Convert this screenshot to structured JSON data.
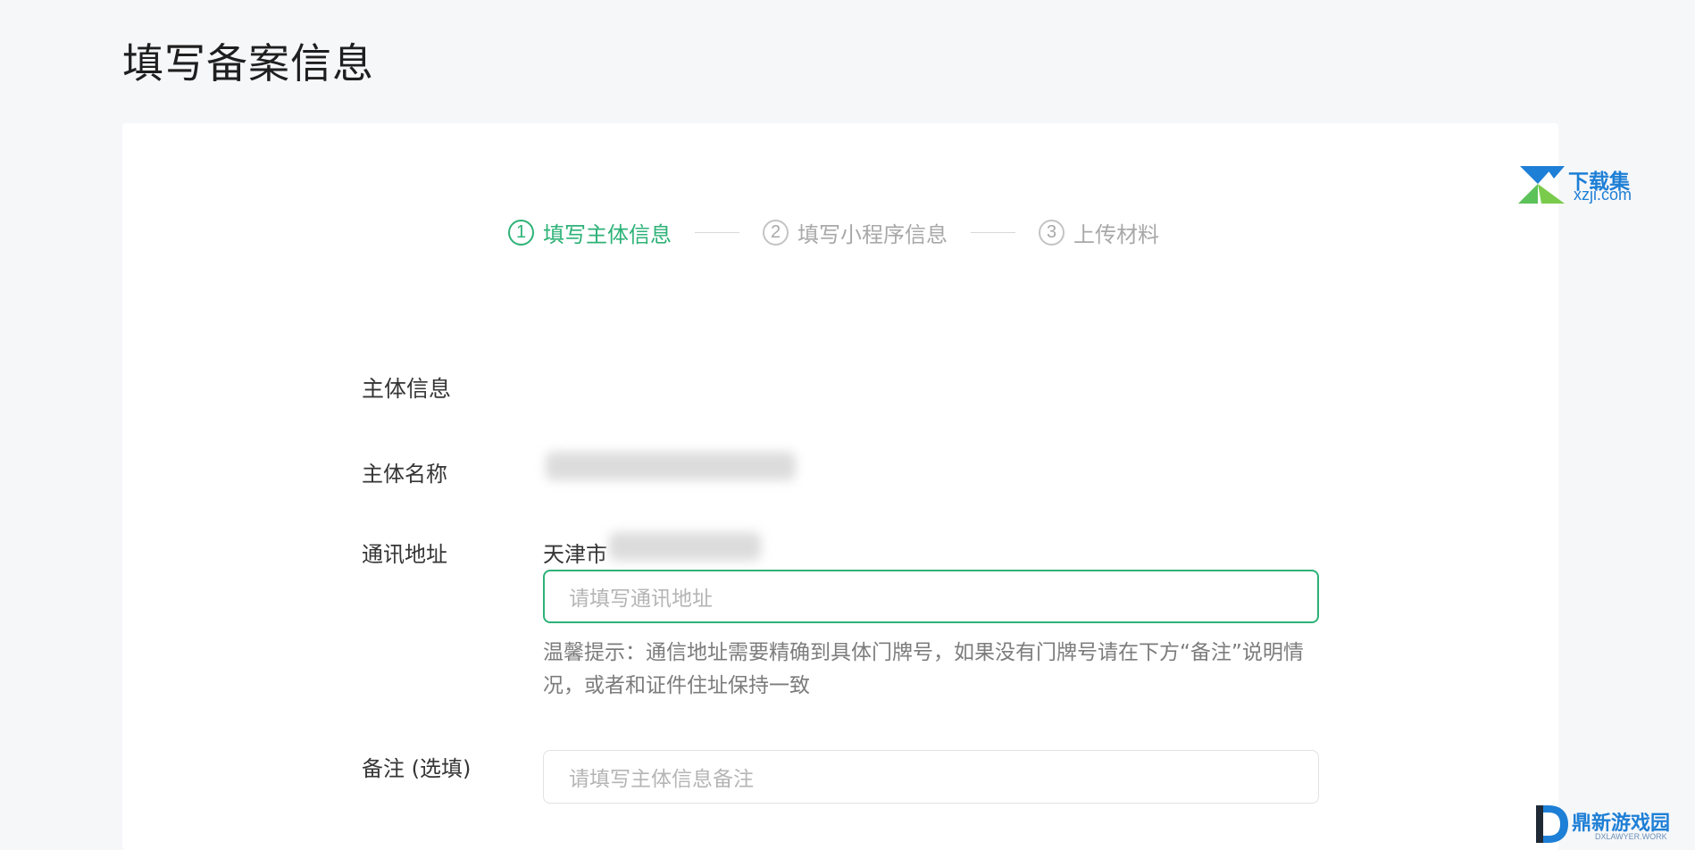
{
  "page": {
    "title": "填写备案信息"
  },
  "steps": [
    {
      "num": "1",
      "label": "填写主体信息",
      "active": true
    },
    {
      "num": "2",
      "label": "填写小程序信息",
      "active": false
    },
    {
      "num": "3",
      "label": "上传材料",
      "active": false
    }
  ],
  "form": {
    "section_title": "主体信息",
    "entity_name_label": "主体名称",
    "address_label": "通讯地址",
    "address_prefix": "天津市",
    "address_placeholder": "请填写通讯地址",
    "address_hint": "温馨提示：通信地址需要精确到具体门牌号，如果没有门牌号请在下方“备注”说明情况，或者和证件住址保持一致",
    "remark_label": "备注 (选填)",
    "remark_placeholder": "请填写主体信息备注"
  },
  "watermarks": {
    "top_title": "下载集",
    "top_url": "xzji.com",
    "bottom_title": "鼎新游戏园",
    "bottom_sub": "DXLAWYER.WORK"
  },
  "colors": {
    "accent": "#2db277",
    "muted": "#a8a8a8",
    "background": "#f6f7f9"
  }
}
